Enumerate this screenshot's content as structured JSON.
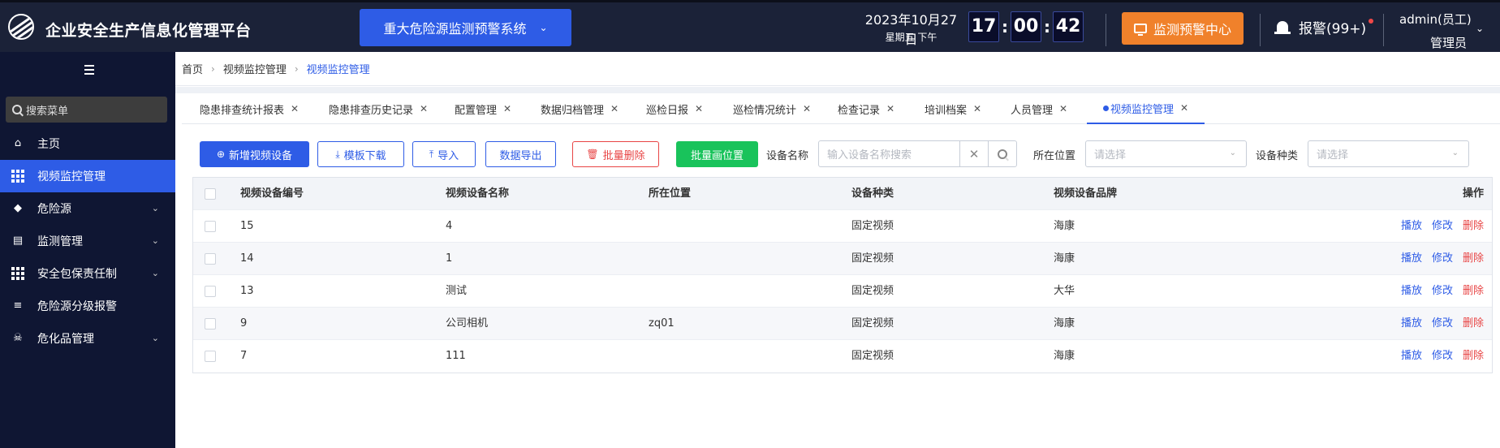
{
  "app": {
    "title": "企业安全生产信息化管理平台"
  },
  "header": {
    "system_select": "重大危险源监测预警系统",
    "date": "2023年10月27日",
    "weekday": "星期五  下午",
    "clock": {
      "h": "17",
      "m": "00",
      "s": "42"
    },
    "monitor_label": "监测预警中心",
    "alarm_label": "报警(99+)",
    "user_name": "admin(员工)",
    "user_role": "管理员"
  },
  "sidebar": {
    "search_placeholder": "搜索菜单",
    "items": [
      {
        "label": "主页",
        "icon": "home-icon"
      },
      {
        "label": "视频监控管理",
        "icon": "grid-icon",
        "active": true
      },
      {
        "label": "危险源",
        "icon": "warning-icon",
        "expandable": true
      },
      {
        "label": "监测管理",
        "icon": "monitor-chart-icon",
        "expandable": true
      },
      {
        "label": "安全包保责任制",
        "icon": "grid-icon",
        "expandable": true
      },
      {
        "label": "危险源分级报警",
        "icon": "layers-icon"
      },
      {
        "label": "危化品管理",
        "icon": "skull-icon",
        "expandable": true
      }
    ]
  },
  "breadcrumb": [
    "首页",
    "视频监控管理",
    "视频监控管理"
  ],
  "tabs": [
    {
      "label": "隐患排查统计报表"
    },
    {
      "label": "隐患排查历史记录"
    },
    {
      "label": "配置管理"
    },
    {
      "label": "数据归档管理"
    },
    {
      "label": "巡检日报"
    },
    {
      "label": "巡检情况统计"
    },
    {
      "label": "检查记录"
    },
    {
      "label": "培训档案"
    },
    {
      "label": "人员管理"
    },
    {
      "label": "视频监控管理",
      "active": true
    }
  ],
  "toolbar": {
    "add_label": "新增视频设备",
    "template_label": "模板下载",
    "import_label": "导入",
    "export_label": "数据导出",
    "batch_delete_label": "批量删除",
    "batch_draw_label": "批量画位置"
  },
  "filters": {
    "name_label": "设备名称",
    "name_placeholder": "输入设备名称搜索",
    "location_label": "所在位置",
    "location_placeholder": "请选择",
    "type_label": "设备种类",
    "type_placeholder": "请选择"
  },
  "table": {
    "columns": [
      "视频设备编号",
      "视频设备名称",
      "所在位置",
      "设备种类",
      "视频设备品牌",
      "操作"
    ],
    "actions": [
      "播放",
      "修改",
      "删除"
    ],
    "rows": [
      {
        "id": "15",
        "name": "4",
        "location": "",
        "type": "固定视频",
        "brand": "海康"
      },
      {
        "id": "14",
        "name": "1",
        "location": "",
        "type": "固定视频",
        "brand": "海康"
      },
      {
        "id": "13",
        "name": "测试",
        "location": "",
        "type": "固定视频",
        "brand": "大华"
      },
      {
        "id": "9",
        "name": "公司相机",
        "location": "zq01",
        "type": "固定视频",
        "brand": "海康"
      },
      {
        "id": "7",
        "name": "111",
        "location": "",
        "type": "固定视频",
        "brand": "海康"
      }
    ]
  },
  "colors": {
    "accent": "#2e5ce6",
    "header_bg": "#1b2238",
    "sidebar_bg": "#0f1633",
    "warning_btn": "#f0812b",
    "danger": "#e84545",
    "success": "#19c35b"
  }
}
